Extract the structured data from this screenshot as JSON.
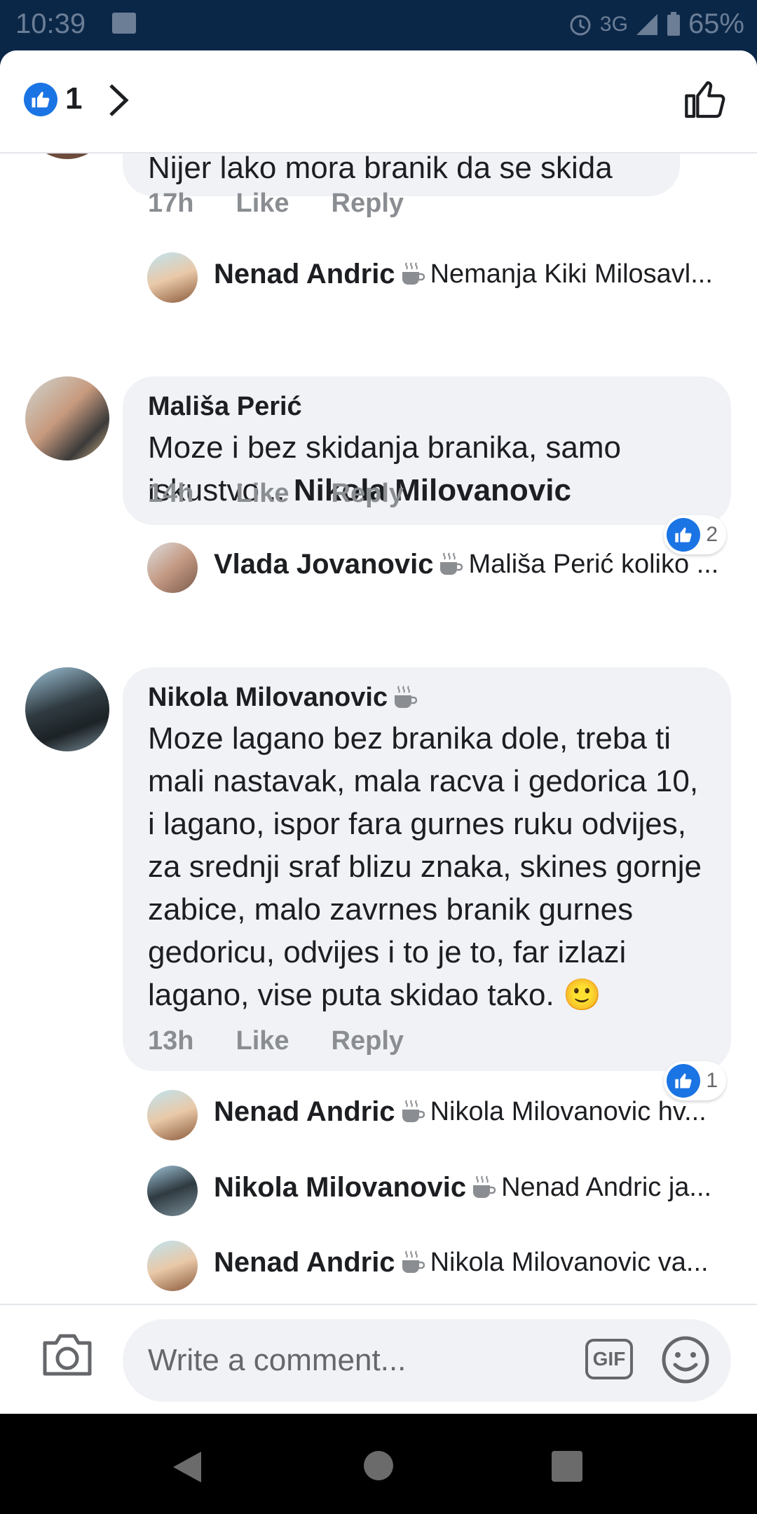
{
  "status_bar": {
    "time": "10:39",
    "network": "3G",
    "battery": "65%"
  },
  "header": {
    "reaction_count": "1"
  },
  "comments": [
    {
      "text_partial": "Nijer lako mora branik da se skida",
      "time": "17h",
      "like": "Like",
      "reply": "Reply"
    },
    {
      "author": "Mališa Perić",
      "text": "Moze i bez skidanja branika, samo iskustvo...",
      "mention": "Nikola Milovanovic",
      "time": "14h",
      "like": "Like",
      "reply": "Reply",
      "reactions": "2"
    },
    {
      "author": "Nikola Milovanovic",
      "text": "Moze lagano bez branika dole, treba ti mali nastavak, mala racva i gedorica 10, i lagano, ispor fara gurnes ruku  odvijes, za srednji sraf blizu znaka, skines gornje zabice, malo zavrnes branik gurnes gedoricu, odvijes i to je to, far izlazi lagano, vise puta skidao tako. 🙂",
      "time": "13h",
      "like": "Like",
      "reply": "Reply",
      "reactions": "1"
    }
  ],
  "replies": [
    {
      "name": "Nenad Andric",
      "preview": "Nemanja Kiki Milosavl..."
    },
    {
      "name": "Vlada Jovanovic",
      "preview": "Mališa Perić koliko ..."
    },
    {
      "name": "Nenad Andric",
      "preview": "Nikola Milovanovic hv..."
    },
    {
      "name": "Nikola Milovanovic",
      "preview": "Nenad Andric ja..."
    },
    {
      "name": "Nenad Andric",
      "preview": "Nikola Milovanovic va..."
    }
  ],
  "composer": {
    "placeholder": "Write a comment...",
    "gif": "GIF"
  },
  "colors": {
    "accent": "#1b74e4",
    "bubble": "#f0f2f5",
    "meta": "#8a8d91",
    "statusbar": "#0b2748"
  },
  "icons": [
    "like-badge-icon",
    "chevron-right-icon",
    "thumbs-up-outline-icon",
    "coffee-cup-icon",
    "camera-icon",
    "gif-icon",
    "emoji-icon",
    "back-nav-icon",
    "home-nav-icon",
    "recents-nav-icon"
  ]
}
